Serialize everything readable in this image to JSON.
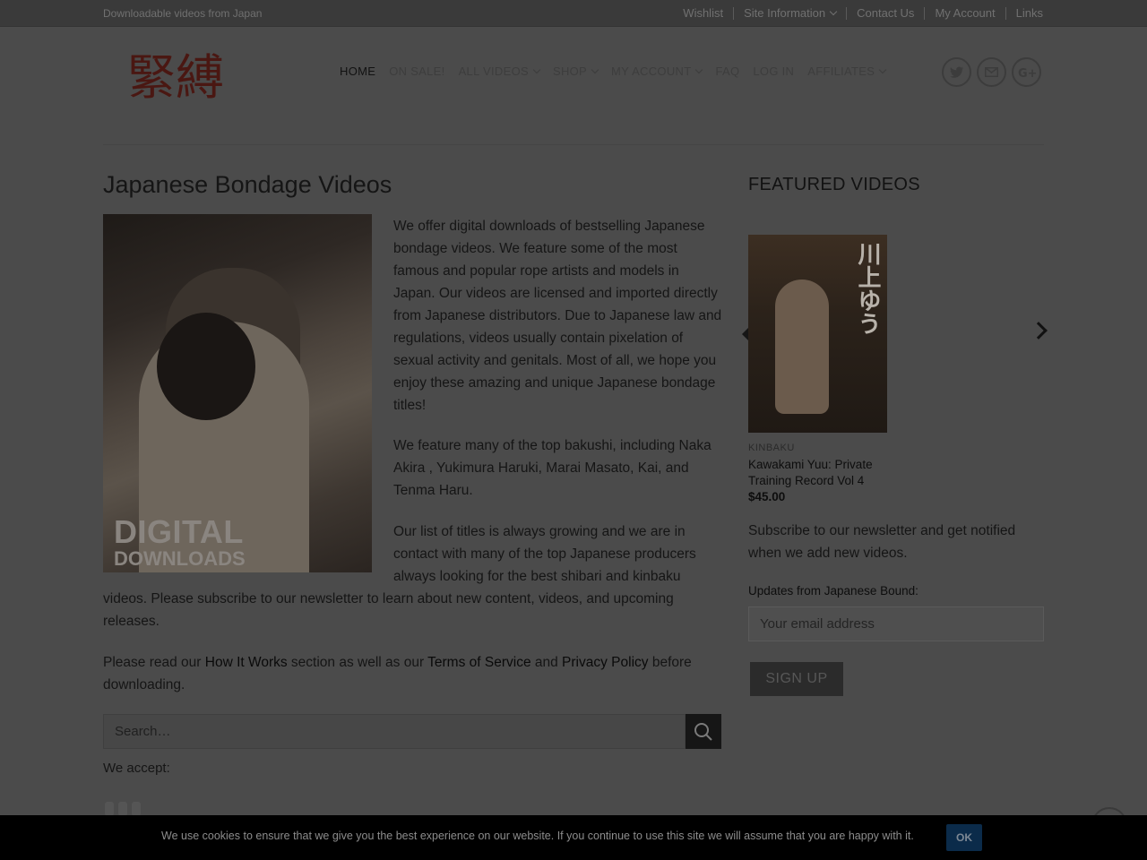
{
  "topbar": {
    "tagline": "Downloadable videos from Japan",
    "links": [
      "Wishlist",
      "Site Information",
      "Contact Us",
      "My Account",
      "Links"
    ]
  },
  "header": {
    "logo_text": "緊縛",
    "nav": [
      "HOME",
      "ON SALE!",
      "ALL VIDEOS",
      "SHOP",
      "MY ACCOUNT",
      "FAQ",
      "LOG IN",
      "AFFILIATES"
    ],
    "social": [
      "twitter-icon",
      "email-icon",
      "google-plus-icon"
    ]
  },
  "main": {
    "title": "Japanese Bondage Videos",
    "hero_line1": "DIGITAL",
    "hero_line2": "DOWNLOADS",
    "p1": "We offer digital downloads of bestselling Japanese bondage videos.  We feature some of the most famous and popular rope artists and models in Japan.  Our videos are licensed and imported directly from Japanese distributors. Due to Japanese law and regulations, videos usually contain pixelation of sexual activity and genitals.  Most of all, we hope you enjoy these amazing and unique Japanese bondage titles!",
    "p2": "We feature many of the top bakushi, including Naka Akira , Yukimura Haruki, Marai Masato, Kai, and Tenma Haru.",
    "p3a": "Our list of titles is always growing and we are in contact with many of the top Japanese producers always looking for the best shibari and kinbaku",
    "p3b": "videos.  Please subscribe to our newsletter to learn about new content, videos, and upcoming releases.",
    "p4_pre": "Please read our ",
    "p4_link1": "How It Works",
    "p4_mid1": " section as well as our ",
    "p4_link2": "Terms of Service",
    "p4_mid2": " and ",
    "p4_link3": "Privacy Policy",
    "p4_post": " before downloading.",
    "search_placeholder": "Search…",
    "accept_label": "We accept:"
  },
  "sidebar": {
    "title": "FEATURED VIDEOS",
    "product": {
      "cover_text": "川上ゆう",
      "category": "KINBAKU",
      "name": "Kawakami Yuu: Private Training Record Vol 4",
      "price": "$45.00"
    },
    "subscribe_text": "Subscribe to our newsletter and get notified when we add new videos.",
    "updates_label": "Updates from Japanese Bound:",
    "email_placeholder": "Your email address",
    "signup_label": "SIGN UP"
  },
  "cookie": {
    "message": "We use cookies to ensure that we give you the best experience on our website. If you continue to use this site we will assume that you are happy with it.",
    "ok_label": "OK"
  }
}
